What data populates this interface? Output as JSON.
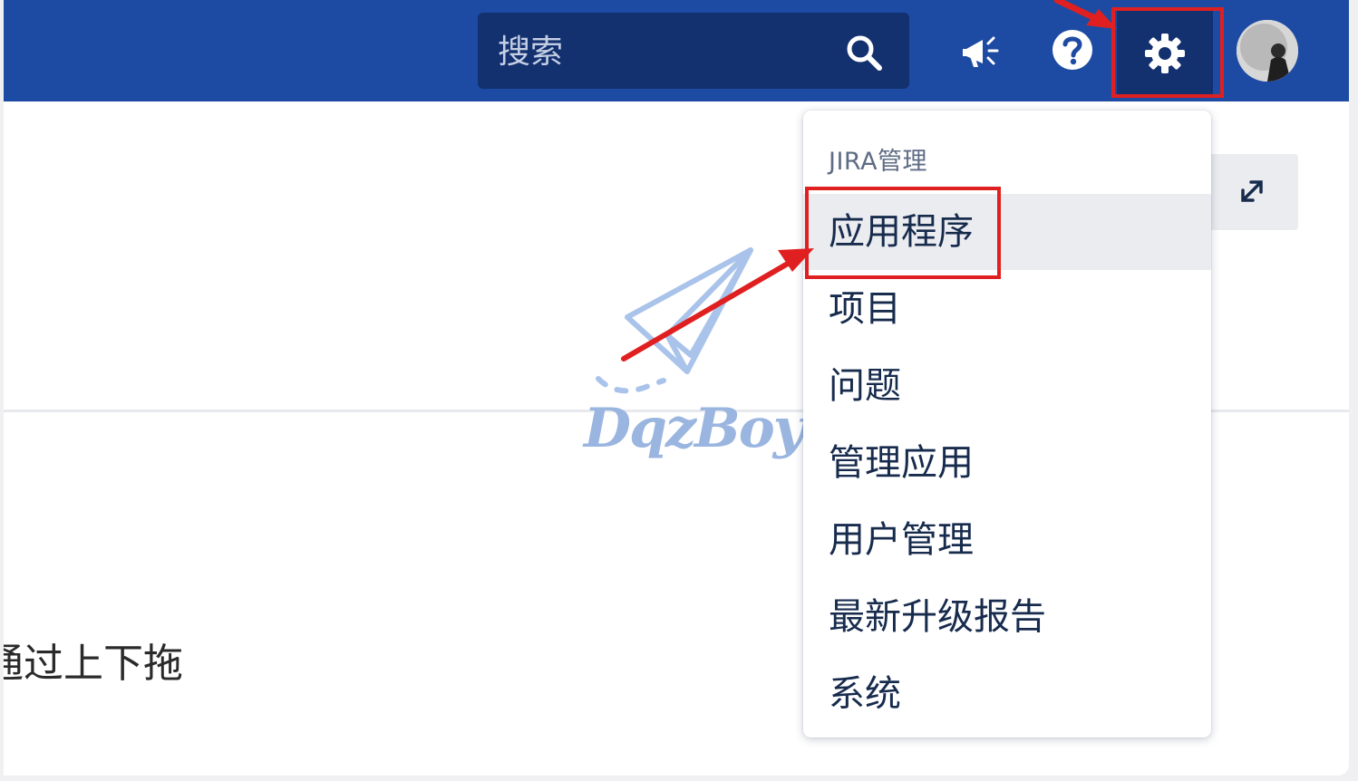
{
  "header": {
    "search": {
      "placeholder": "搜索"
    },
    "icons": {
      "search": "search-icon",
      "notifications": "megaphone-icon",
      "help": "help-icon",
      "settings": "gear-icon",
      "avatar": "user-avatar"
    }
  },
  "admin_menu": {
    "heading": "JIRA管理",
    "items": [
      {
        "label": "应用程序",
        "active": true
      },
      {
        "label": "项目"
      },
      {
        "label": "问题"
      },
      {
        "label": "管理应用"
      },
      {
        "label": "用户管理"
      },
      {
        "label": "最新升级报告"
      },
      {
        "label": "系统"
      }
    ]
  },
  "content": {
    "text": "通过上下拖",
    "expand_icon": "expand-icon"
  },
  "watermark": {
    "text": "DqzBoy"
  },
  "colors": {
    "header": "#1d4ba3",
    "search_bg": "#13306f",
    "annotation": "#e02020",
    "menu_active": "#ebecf0",
    "watermark": "#9ab5df"
  }
}
